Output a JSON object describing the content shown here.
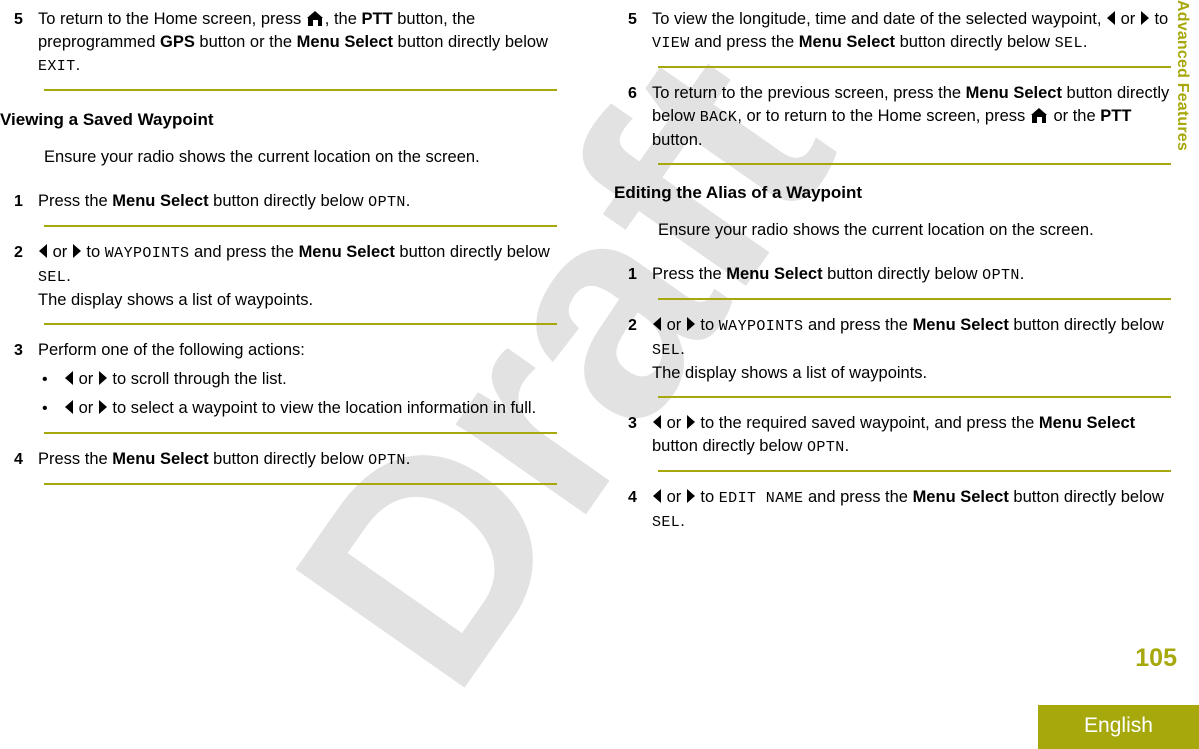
{
  "page": {
    "number": "105",
    "language": "English",
    "side_tab": "Advanced Features",
    "watermark": "Draft"
  },
  "colors": {
    "accent": "#a6a80c",
    "text": "#000000",
    "watermark": "#e2e2e2"
  },
  "left_column": {
    "step5": {
      "num": "5",
      "t1": "To return to the Home screen, press ",
      "t2": ", the ",
      "b1": "PTT",
      "t3": " button, the preprogrammed ",
      "b2": "GPS",
      "t4": " button or the ",
      "b3": "Menu Select",
      "t5": " button directly below ",
      "m1": "EXIT",
      "t6": "."
    },
    "heading": "Viewing a Saved Waypoint",
    "intro": "Ensure your radio shows the current location on the screen.",
    "step1": {
      "num": "1",
      "t1": "Press the ",
      "b1": "Menu Select",
      "t2": " button directly below ",
      "m1": "OPTN",
      "t3": "."
    },
    "step2": {
      "num": "2",
      "t1": " or ",
      "t2": " to ",
      "m1": "WAYPOINTS",
      "t3": " and press the ",
      "b1": "Menu Select",
      "t4": " button directly below ",
      "m2": "SEL",
      "t5": ".",
      "t6": "The display shows a list of waypoints."
    },
    "step3": {
      "num": "3",
      "t1": "Perform one of the following actions:",
      "bullets": [
        {
          "t1": " or ",
          "t2": " to scroll through the list."
        },
        {
          "t1": " or ",
          "t2": " to select a waypoint to view the location information in full."
        }
      ]
    },
    "step4": {
      "num": "4",
      "t1": "Press the ",
      "b1": "Menu Select",
      "t2": " button directly below ",
      "m1": "OPTN",
      "t3": "."
    }
  },
  "right_column": {
    "step5": {
      "num": "5",
      "t1": "To view the longitude, time and date of the selected waypoint, ",
      "t2": " or ",
      "t3": " to ",
      "m1": "VIEW",
      "t4": " and press the ",
      "b1": "Menu Select",
      "t5": " button directly below ",
      "m2": "SEL",
      "t6": "."
    },
    "step6": {
      "num": "6",
      "t1": "To return to the previous screen, press the ",
      "b1": "Menu Select",
      "t2": " button directly below ",
      "m1": "BACK",
      "t3": ", or to return to the Home screen, press ",
      "t4": " or the ",
      "b2": "PTT",
      "t5": " button."
    },
    "heading": "Editing the Alias of a Waypoint",
    "intro": "Ensure your radio shows the current location on the screen.",
    "step1": {
      "num": "1",
      "t1": "Press the ",
      "b1": "Menu Select",
      "t2": " button directly below ",
      "m1": "OPTN",
      "t3": "."
    },
    "step2": {
      "num": "2",
      "t1": " or ",
      "t2": " to ",
      "m1": "WAYPOINTS",
      "t3": " and press the ",
      "b1": "Menu Select",
      "t4": " button directly below ",
      "m2": "SEL",
      "t5": ".",
      "t6": "The display shows a list of waypoints."
    },
    "step3": {
      "num": "3",
      "t1": " or ",
      "t2": " to the required saved waypoint, and press the ",
      "b1": "Menu Select",
      "t3": " button directly below ",
      "m1": "OPTN",
      "t4": "."
    },
    "step4": {
      "num": "4",
      "t1": " or ",
      "t2": " to ",
      "m1": "EDIT NAME",
      "t3": " and press the ",
      "b1": "Menu Select",
      "t4": " button directly below ",
      "m2": "SEL",
      "t5": "."
    }
  }
}
